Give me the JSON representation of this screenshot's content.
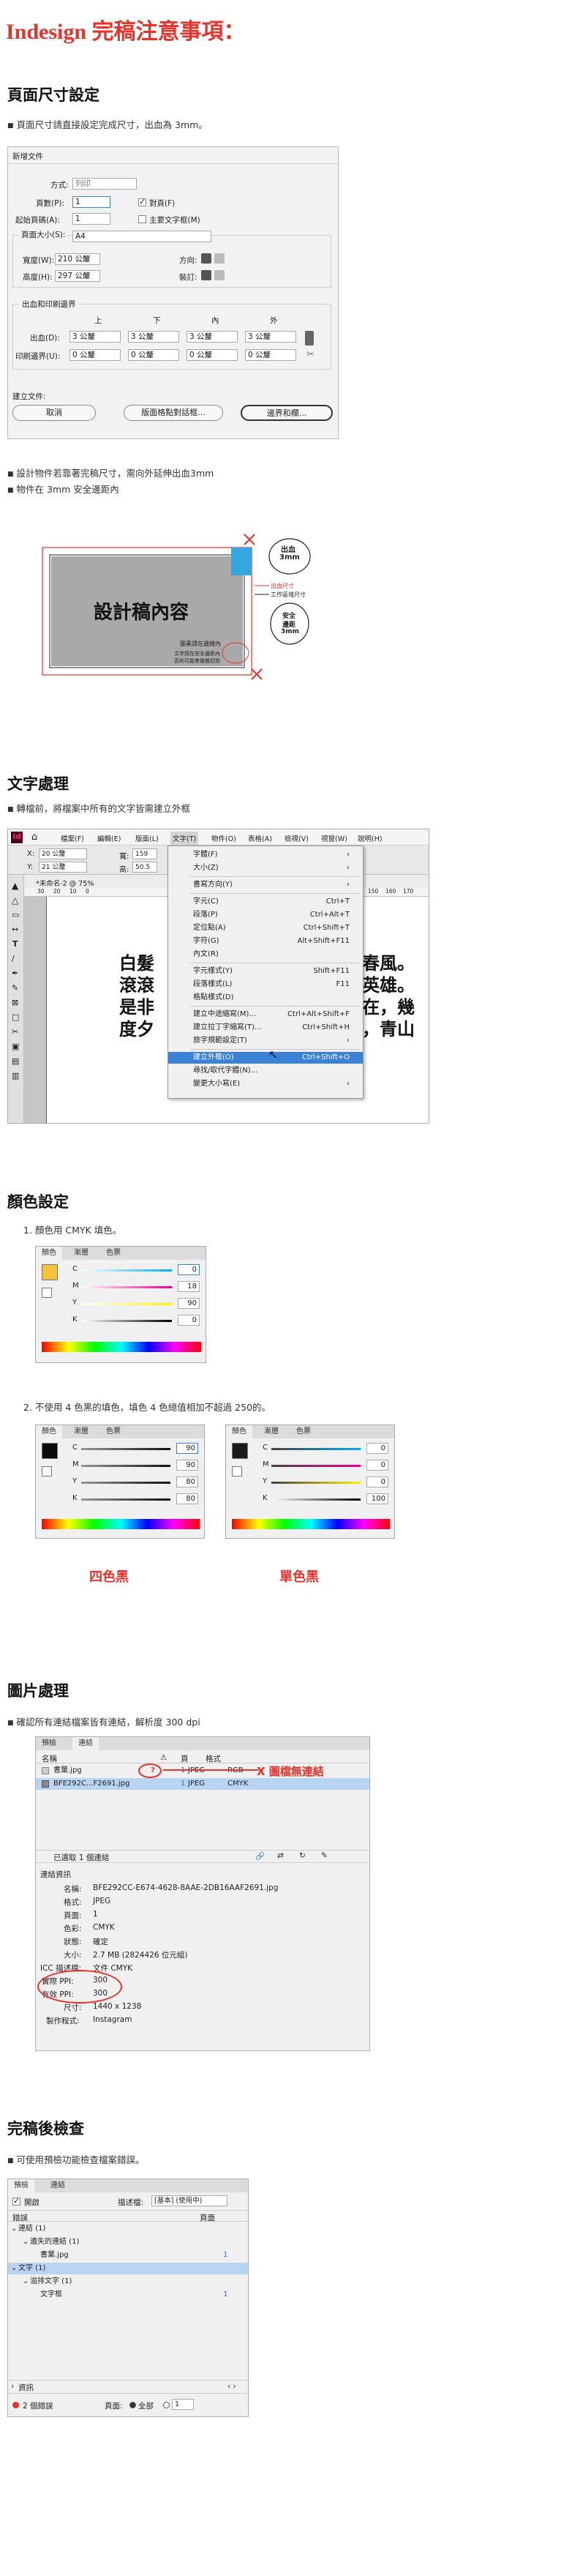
{
  "title": "Indesign 完稿注意事項：",
  "section_page": {
    "heading": "頁面尺寸設定",
    "bullet1": "頁面尺寸請直接設定完成尺寸，出血為 3mm。",
    "dialog": {
      "window_title": "新增文件",
      "intent_label": "方式:",
      "intent_value": "列印",
      "pages_label": "頁數(P):",
      "pages_value": "1",
      "facing_label": "對頁(F)",
      "start_label": "起始頁碼(A):",
      "start_value": "1",
      "master_label": "主要文字框(M)",
      "size_label": "頁面大小(S):",
      "size_value": "A4",
      "width_label": "寬度(W):",
      "width_value": "210 公釐",
      "height_label": "高度(H):",
      "height_value": "297 公釐",
      "orient_label": "方向:",
      "binding_label": "裝訂:",
      "bleed_section": "出血和印刷邊界",
      "col_top": "上",
      "col_bottom": "下",
      "col_inside": "內",
      "col_outside": "外",
      "bleed_label": "出血(D):",
      "bleed_values": [
        "3 公釐",
        "3 公釐",
        "3 公釐",
        "3 公釐"
      ],
      "slug_label": "印刷邊界(U):",
      "slug_values": [
        "0 公釐",
        "0 公釐",
        "0 公釐",
        "0 公釐"
      ],
      "create_label": "建立文件:",
      "cancel_button": "取消",
      "layout_button": "版面格點對話框...",
      "margins_button": "邊界和欄..."
    },
    "bullet2": "設計物件若靠著完稿尺寸，需向外延伸出血3mm",
    "bullet3": "物件在 3mm 安全邊距內",
    "diagram": {
      "design_text": "設計稿內容",
      "bleed_bubble_1": "出血",
      "bleed_bubble_2": "3mm",
      "bleed_line": "出血尺寸",
      "trim_line": "工作區域尺寸",
      "safe_bubble_1": "安全",
      "safe_bubble_2": "邊距",
      "safe_bubble_3": "3mm",
      "inside_text": "圖素請在邊線內",
      "note_text_1": "文字請在安全邊距內",
      "note_text_2": "否則可能會被裁切到"
    }
  },
  "section_text": {
    "heading": "文字處理",
    "bullet1": "轉檔前，將檔案中所有的文字皆需建立外框",
    "menubar": [
      "檔案(F)",
      "編輯(E)",
      "版面(L)",
      "文字(T)",
      "物件(O)",
      "表格(A)",
      "檢視(V)",
      "視窗(W)",
      "說明(H)"
    ],
    "tab_label": "*未命名-2 @ 75%",
    "x_label": "X:",
    "x_value": "20 公釐",
    "y_label": "Y:",
    "y_value": "21 公釐",
    "w_label": "寬:",
    "w_value": "159",
    "h_label": "高:",
    "h_value": "50.5",
    "ruler_left": [
      "30",
      "20",
      "10",
      "0"
    ],
    "ruler_right": [
      "150",
      "160",
      "170"
    ],
    "menu_items": [
      {
        "label": "字體(F)",
        "shortcut": ""
      },
      {
        "label": "大小(Z)",
        "shortcut": ""
      },
      {
        "label": "書寫方向(Y)",
        "shortcut": ""
      },
      {
        "label": "字元(C)",
        "shortcut": "Ctrl+T"
      },
      {
        "label": "段落(P)",
        "shortcut": "Ctrl+Alt+T"
      },
      {
        "label": "定位點(A)",
        "shortcut": "Ctrl+Shift+T"
      },
      {
        "label": "字符(G)",
        "shortcut": "Alt+Shift+F11"
      },
      {
        "label": "內文(R)",
        "shortcut": ""
      },
      {
        "label": "字元樣式(Y)",
        "shortcut": "Shift+F11"
      },
      {
        "label": "段落樣式(L)",
        "shortcut": "F11"
      },
      {
        "label": "格點樣式(D)",
        "shortcut": ""
      },
      {
        "label": "建立中途縮寫(M)...",
        "shortcut": "Ctrl+Alt+Shift+F"
      },
      {
        "label": "建立拉丁字縮寫(T)...",
        "shortcut": "Ctrl+Shift+H"
      },
      {
        "label": "旅字規範設定(T)",
        "shortcut": ""
      },
      {
        "label": "建立外框(O)",
        "shortcut": "Ctrl+Shift+O"
      },
      {
        "label": "尋找/取代字體(N)...",
        "shortcut": ""
      },
      {
        "label": "變更大小寫(E)",
        "shortcut": ""
      }
    ],
    "sample_left": [
      "白髮",
      "滾滾",
      "是非",
      "度夕"
    ],
    "sample_right": [
      "春風。",
      "英雄。",
      "在，幾",
      "，青山"
    ]
  },
  "section_color": {
    "heading": "顏色設定",
    "item1": "1. 顏色用 CMYK 填色。",
    "item2": "2. 不使用 4 色黑的填色，填色 4 色總值相加不超過 250的。",
    "tabs": [
      "顏色",
      "漸層",
      "色票"
    ],
    "channels": [
      "C",
      "M",
      "Y",
      "K"
    ],
    "panel1_values": [
      "0",
      "18",
      "90",
      "0"
    ],
    "panel2_values": [
      "90",
      "90",
      "80",
      "80"
    ],
    "panel3_values": [
      "0",
      "0",
      "0",
      "100"
    ],
    "panel1_swatch": "#f5c33b",
    "panel2_swatch": "#0a0a0a",
    "panel3_swatch": "#1a1a1a",
    "label_rich": "四色黑",
    "label_single": "單色黑"
  },
  "section_image": {
    "heading": "圖片處理",
    "bullet1": "確認所有連結檔案皆有連結，解析度 300 dpi",
    "tabs": [
      "預檢",
      "連結"
    ],
    "col_name": "名稱",
    "col_page": "頁",
    "col_format": "格式",
    "files": [
      {
        "name": "書葉.jpg",
        "page": "1",
        "format": "JPEG",
        "space": "RGB"
      },
      {
        "name": "BFE292C...F2691.jpg",
        "page": "1",
        "format": "JPEG",
        "space": "CMYK"
      }
    ],
    "missing_label": "X 圖檔無連結",
    "selected_count": "已選取 1 個連結",
    "info_header": "連結資訊",
    "info": [
      {
        "k": "名稱:",
        "v": "BFE292CC-E674-4628-8AAE-2DB16AAF2691.jpg"
      },
      {
        "k": "格式:",
        "v": "JPEG"
      },
      {
        "k": "頁面:",
        "v": "1"
      },
      {
        "k": "色彩:",
        "v": "CMYK"
      },
      {
        "k": "狀態:",
        "v": "確定"
      },
      {
        "k": "大小:",
        "v": "2.7 MB (2824426 位元組)"
      },
      {
        "k": "ICC 描述檔:",
        "v": "文件 CMYK"
      },
      {
        "k": "實際 PPI:",
        "v": "300"
      },
      {
        "k": "有效 PPI:",
        "v": "300"
      },
      {
        "k": "尺寸:",
        "v": "1440 x 1238"
      },
      {
        "k": "製作程式:",
        "v": "Instagram"
      }
    ]
  },
  "section_check": {
    "heading": "完稿後檢查",
    "bullet1": "可使用預檢功能檢查檔案錯誤。",
    "tabs": [
      "預檢",
      "連結"
    ],
    "on_label": "開啟",
    "profile_label": "描述檔:",
    "profile_value": "[基本] (使用中)",
    "col_error": "錯誤",
    "col_page": "頁面",
    "tree": [
      {
        "label": "連結 (1)",
        "level": 0,
        "page": ""
      },
      {
        "label": "遺失的連結 (1)",
        "level": 1,
        "page": ""
      },
      {
        "label": "書葉.jpg",
        "level": 2,
        "page": "1"
      },
      {
        "label": "文字 (1)",
        "level": 0,
        "page": ""
      },
      {
        "label": "溢排文字 (1)",
        "level": 1,
        "page": ""
      },
      {
        "label": "文字框",
        "level": 2,
        "page": "1"
      }
    ],
    "info_label": "資訊",
    "error_count": "2 個錯誤",
    "pages_label": "頁面:",
    "all_label": "全部",
    "range_value": "1"
  }
}
